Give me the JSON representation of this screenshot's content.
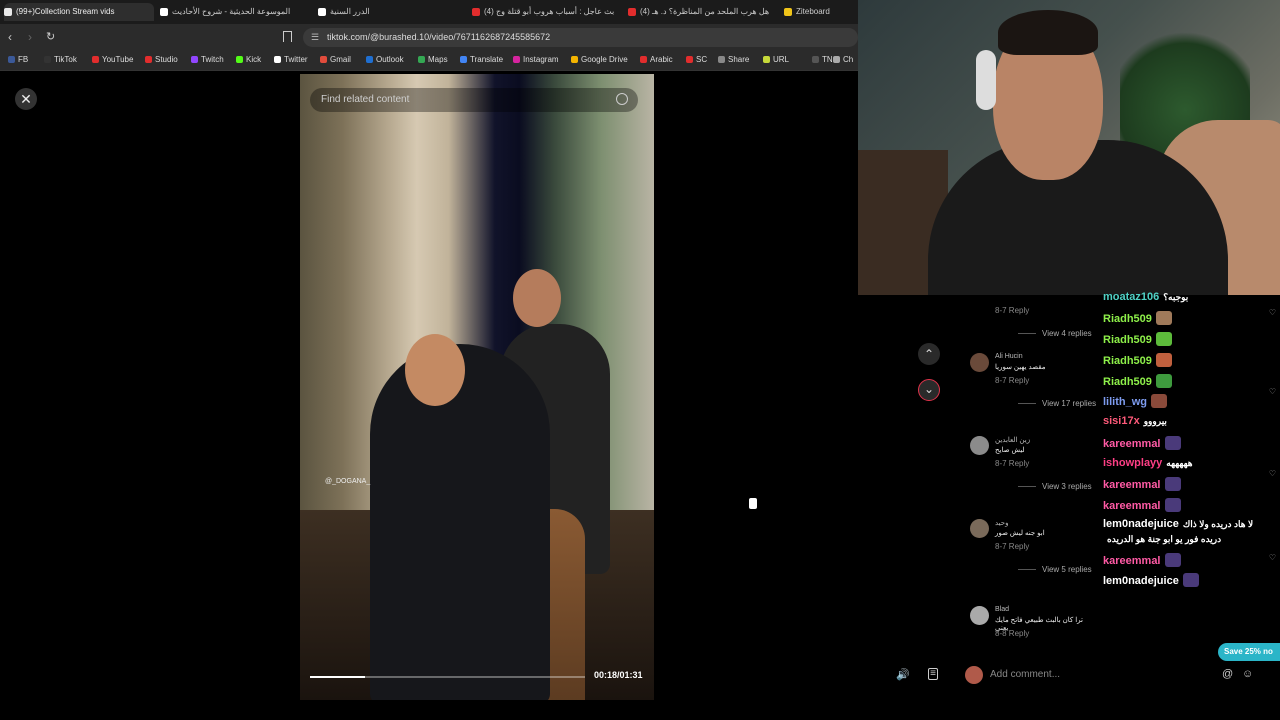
{
  "browser": {
    "tabs": [
      {
        "title": "(99+)Collection Stream vids",
        "color": "#e8e8e8",
        "active": true
      },
      {
        "title": "الموسوعة الحديثية - شروح الأحاديث",
        "color": "#ffffff",
        "active": false
      },
      {
        "title": "الدرر السنية",
        "color": "#ffffff",
        "active": false
      },
      {
        "title": "(4) بث عاجل : أسباب هروب أبو قتلة وج",
        "color": "#e22d2d",
        "active": false
      },
      {
        "title": "(4) هل هرب الملحد من المناظرة؟ د. هـ",
        "color": "#e22d2d",
        "active": false
      },
      {
        "title": "Ziteboard",
        "color": "#f0c419",
        "active": false
      }
    ],
    "url": "tiktok.com/@burashed.10/video/7671162687245585672",
    "bookmarks": [
      {
        "label": "FB",
        "color": "#3b5998"
      },
      {
        "label": "TikTok",
        "color": "#333333"
      },
      {
        "label": "YouTube",
        "color": "#e22d2d"
      },
      {
        "label": "Studio",
        "color": "#e22d2d"
      },
      {
        "label": "Twitch",
        "color": "#9146ff"
      },
      {
        "label": "Kick",
        "color": "#53fc18"
      },
      {
        "label": "Twitter",
        "color": "#ffffff"
      },
      {
        "label": "Gmail",
        "color": "#e24c3c"
      },
      {
        "label": "Outlook",
        "color": "#1f6fd1"
      },
      {
        "label": "Maps",
        "color": "#34a853"
      },
      {
        "label": "Translate",
        "color": "#4285f4"
      },
      {
        "label": "Instagram",
        "color": "#d6249f"
      },
      {
        "label": "Google Drive",
        "color": "#f4b400"
      },
      {
        "label": "Arabic",
        "color": "#e22d2d"
      },
      {
        "label": "SC",
        "color": "#e22d2d"
      },
      {
        "label": "Share",
        "color": "#888888"
      },
      {
        "label": "URL",
        "color": "#c6d93a"
      },
      {
        "label": "TN",
        "color": "#555555"
      },
      {
        "label": "Ch",
        "color": "#aaaaaa"
      }
    ]
  },
  "video": {
    "search_placeholder": "Find related content",
    "watermark": "@_DOGANA_",
    "timestamp": "00:18/01:31",
    "progress": 0.2
  },
  "comments": [
    {
      "name": "",
      "text": "",
      "meta": "8-7  Reply",
      "replies": "View 4 replies"
    },
    {
      "name": "Ali Hucin",
      "text": "مقصد يهين سوريا",
      "meta": "8-7  Reply",
      "replies": "View 17 replies"
    },
    {
      "name": "زين العابدين",
      "text": "ليش صايح",
      "meta": "8-7  Reply",
      "replies": "View 3 replies"
    },
    {
      "name": "وحيد",
      "text": "ابو جنه ليش صور",
      "meta": "8-7  Reply",
      "replies": "View 5 replies"
    },
    {
      "name": "Blad",
      "text": "ترا كان بالبث طبيعي فاتح مايك يعني",
      "meta": "8-8  Reply",
      "replies": ""
    }
  ],
  "chat": [
    {
      "user": "moataz106",
      "color": "#4fd1c5",
      "msg": "بوجبه؟",
      "emote": ""
    },
    {
      "user": "Riadh509",
      "color": "#8ef04a",
      "msg": "",
      "emote": "#a07a5a"
    },
    {
      "user": "Riadh509",
      "color": "#8ef04a",
      "msg": "",
      "emote": "#5dbb3b"
    },
    {
      "user": "Riadh509",
      "color": "#8ef04a",
      "msg": "",
      "emote": "#c0603e"
    },
    {
      "user": "Riadh509",
      "color": "#8ef04a",
      "msg": "",
      "emote": "#3e9b3e"
    },
    {
      "user": "lilith_wg",
      "color": "#7e9cf0",
      "msg": "",
      "emote": "#8a4a3a"
    },
    {
      "user": "sisi17x",
      "color": "#ff5a7a",
      "msg": "بيرووو",
      "emote": ""
    },
    {
      "user": "kareemmal",
      "color": "#ff5aa5",
      "msg": "",
      "emote": "#4a3a7a"
    },
    {
      "user": "ishowplayy",
      "color": "#ff3f86",
      "msg": "هههههه",
      "emote": ""
    },
    {
      "user": "kareemmal",
      "color": "#ff5aa5",
      "msg": "",
      "emote": "#4a3a7a"
    },
    {
      "user": "kareemmal",
      "color": "#ff5aa5",
      "msg": "",
      "emote": "#4a3a7a"
    },
    {
      "user": "lem0nadejuice",
      "color": "#ffffff",
      "msg": "لا هاد دريده ولا ذاك",
      "emote": ""
    },
    {
      "user": "",
      "color": "#ffffff",
      "msg": "دريده فور يو ابو جنة هو الدريده",
      "emote": ""
    },
    {
      "user": "kareemmal",
      "color": "#ff5aa5",
      "msg": "",
      "emote": "#4a3a7a"
    },
    {
      "user": "lem0nadejuice",
      "color": "#ffffff",
      "msg": "",
      "emote": "#4a3a7a"
    }
  ],
  "promo": {
    "label": "Save 25% no"
  },
  "comment_bar": {
    "placeholder": "Add comment..."
  },
  "icons": {
    "close": "close-icon",
    "up": "chevron-up-icon",
    "down": "chevron-down-icon",
    "volume": "volume-icon",
    "mention": "at-icon",
    "emoji": "emoji-icon"
  }
}
